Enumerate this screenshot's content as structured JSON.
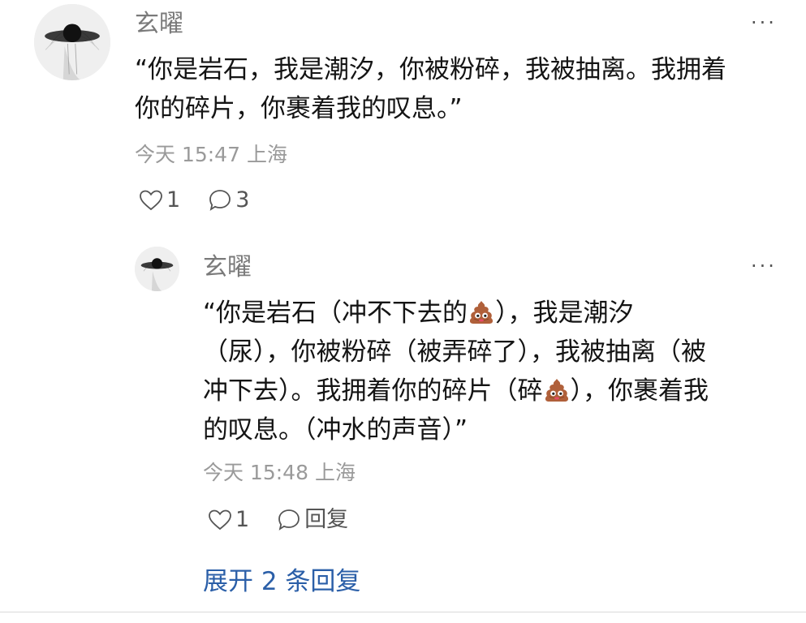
{
  "comment": {
    "username": "玄曜",
    "more_label": "···",
    "text_lines": [
      "“你是岩石，我是潮汐，你被粉碎，我被抽离。我拥着",
      "你的碎片，你裹着我的叹息。”"
    ],
    "meta": "今天 15:47 上海",
    "like_count": "1",
    "reply_count": "3"
  },
  "reply": {
    "username": "玄曜",
    "more_label": "···",
    "text_lines": {
      "l1a": "“你是岩石（冲不下去的",
      "l1b": "），我是潮汐",
      "l2": "（尿），你被粉碎（被弄碎了），我被抽离（被",
      "l3a": "冲下去）。我拥着你的碎片（碎",
      "l3b": "），你裹着我",
      "l4": "的叹息。（冲水的声音）”"
    },
    "emoji_name": "poop-emoji",
    "meta": "今天 15:48 上海",
    "like_count": "1",
    "reply_label": "回复"
  },
  "expand_label": "展开 2 条回复",
  "colors": {
    "username": "#7a7a7a",
    "meta": "#9a9a9a",
    "link": "#2b5fa8",
    "text": "#141414"
  }
}
